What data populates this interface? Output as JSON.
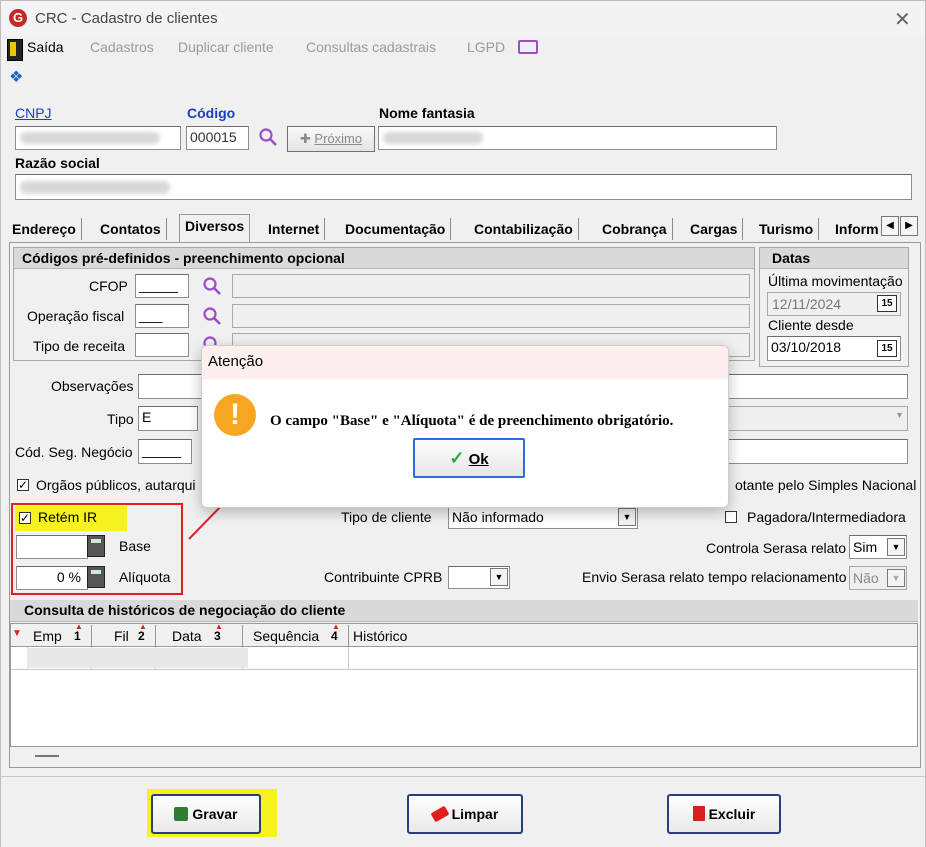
{
  "window": {
    "title": "CRC - Cadastro de clientes",
    "logo_letter": "G"
  },
  "menu": {
    "items": [
      "Saída",
      "Cadastros",
      "Duplicar cliente",
      "Consultas cadastrais",
      "LGPD"
    ]
  },
  "header": {
    "cnpj_label": "CNPJ",
    "codigo_label": "Código",
    "codigo_value": "000015",
    "proximo_label": "Próximo",
    "nome_fantasia_label": "Nome fantasia",
    "razao_social_label": "Razão social"
  },
  "tabs": [
    "Endereço",
    "Contatos",
    "Diversos",
    "Internet",
    "Documentação",
    "Contabilização",
    "Cobrança",
    "Cargas",
    "Turismo",
    "Inform"
  ],
  "codigos": {
    "title": "Códigos pré-definidos - preenchimento opcional",
    "cfop_label": "CFOP",
    "cfop_value": "_____",
    "operacao_label": "Operação fiscal",
    "operacao_value": "___",
    "tipo_receita_label": "Tipo de receita"
  },
  "datas": {
    "title": "Datas",
    "ultima_label": "Última movimentação",
    "ultima_value": "12/11/2024",
    "cliente_desde_label": "Cliente desde",
    "cliente_desde_value": "03/10/2018",
    "cal_label": "15"
  },
  "diversos": {
    "observacoes_label": "Observações",
    "tipo_label": "Tipo",
    "tipo_value": "E",
    "cod_seg_label": "Cód. Seg. Negócio",
    "cod_seg_value": "_____",
    "orgaos_label": "Orgãos públicos, autarqui",
    "optante_label": "otante pelo Simples Nacional",
    "retem_ir_label": "Retém IR",
    "base_label": "Base",
    "aliquota_label": "Alíquota",
    "aliquota_value": "0 %",
    "tipo_cliente_label": "Tipo de cliente",
    "tipo_cliente_value": "Não informado",
    "pagadora_label": "Pagadora/Intermediadora",
    "serasa_label": "Controla Serasa relato",
    "serasa_value": "Sim",
    "cprb_label": "Contribuinte CPRB",
    "envio_serasa_label": "Envio Serasa relato tempo relacionamento",
    "envio_serasa_value": "Não"
  },
  "historico": {
    "title": "Consulta de históricos de negociação do cliente",
    "columns": [
      {
        "label": "Emp",
        "sort": "1"
      },
      {
        "label": "Fil",
        "sort": "2"
      },
      {
        "label": "Data",
        "sort": "3"
      },
      {
        "label": "Sequência",
        "sort": "4"
      },
      {
        "label": "Histórico",
        "sort": ""
      }
    ],
    "rows": []
  },
  "modal": {
    "title": "Atenção",
    "message": "O campo \"Base\" e \"Alíquota\" é de preenchimento obrigatório.",
    "ok_label": "Ok",
    "icon": "warning-icon"
  },
  "footer": {
    "gravar_label": "Gravar",
    "limpar_label": "Limpar",
    "excluir_label": "Excluir"
  },
  "colors": {
    "highlight": "#f5f21e",
    "annotation_red": "#e02020",
    "accent_purple": "#9b4dca",
    "button_border": "#2b3e7a"
  }
}
